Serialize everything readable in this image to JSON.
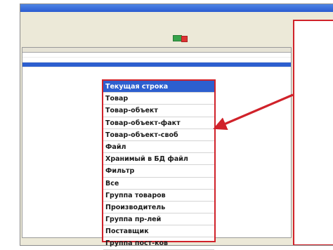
{
  "colors": {
    "accent_red": "#d0222a",
    "selection_blue": "#2d5fcf"
  },
  "window": {
    "title": "",
    "status_text": ""
  },
  "toolbar": {
    "row1": [],
    "row2": []
  },
  "filter_bar": {
    "text": ""
  },
  "grid": {
    "columns": [
      "",
      "",
      "",
      "",
      ""
    ],
    "rows": [
      {
        "cells": [
          "",
          "",
          "",
          "",
          ""
        ],
        "selected": false
      },
      {
        "cells": [
          "",
          "",
          "",
          "",
          ""
        ],
        "selected": false
      },
      {
        "cells": [
          "",
          "",
          "",
          "",
          ""
        ],
        "selected": true
      }
    ]
  },
  "status_bar": {
    "text": ""
  },
  "side_panel": {
    "items": []
  },
  "popup_menu": {
    "items": [
      {
        "label": "Текущая строка",
        "selected": true
      },
      {
        "label": "Товар",
        "selected": false
      },
      {
        "label": "Товар-объект",
        "selected": false
      },
      {
        "label": "Товар-объект-факт",
        "selected": false
      },
      {
        "label": "Товар-объект-своб",
        "selected": false
      },
      {
        "label": "Файл",
        "selected": false
      },
      {
        "label": "Хранимый в БД файл",
        "selected": false
      },
      {
        "label": "Фильтр",
        "selected": false
      },
      {
        "label": "Все",
        "selected": false
      },
      {
        "label": "Группа товаров",
        "selected": false
      },
      {
        "label": "Производитель",
        "selected": false
      },
      {
        "label": "Группа пр-лей",
        "selected": false
      },
      {
        "label": "Поставщик",
        "selected": false
      },
      {
        "label": "Группа пост-ков",
        "selected": false
      }
    ]
  }
}
